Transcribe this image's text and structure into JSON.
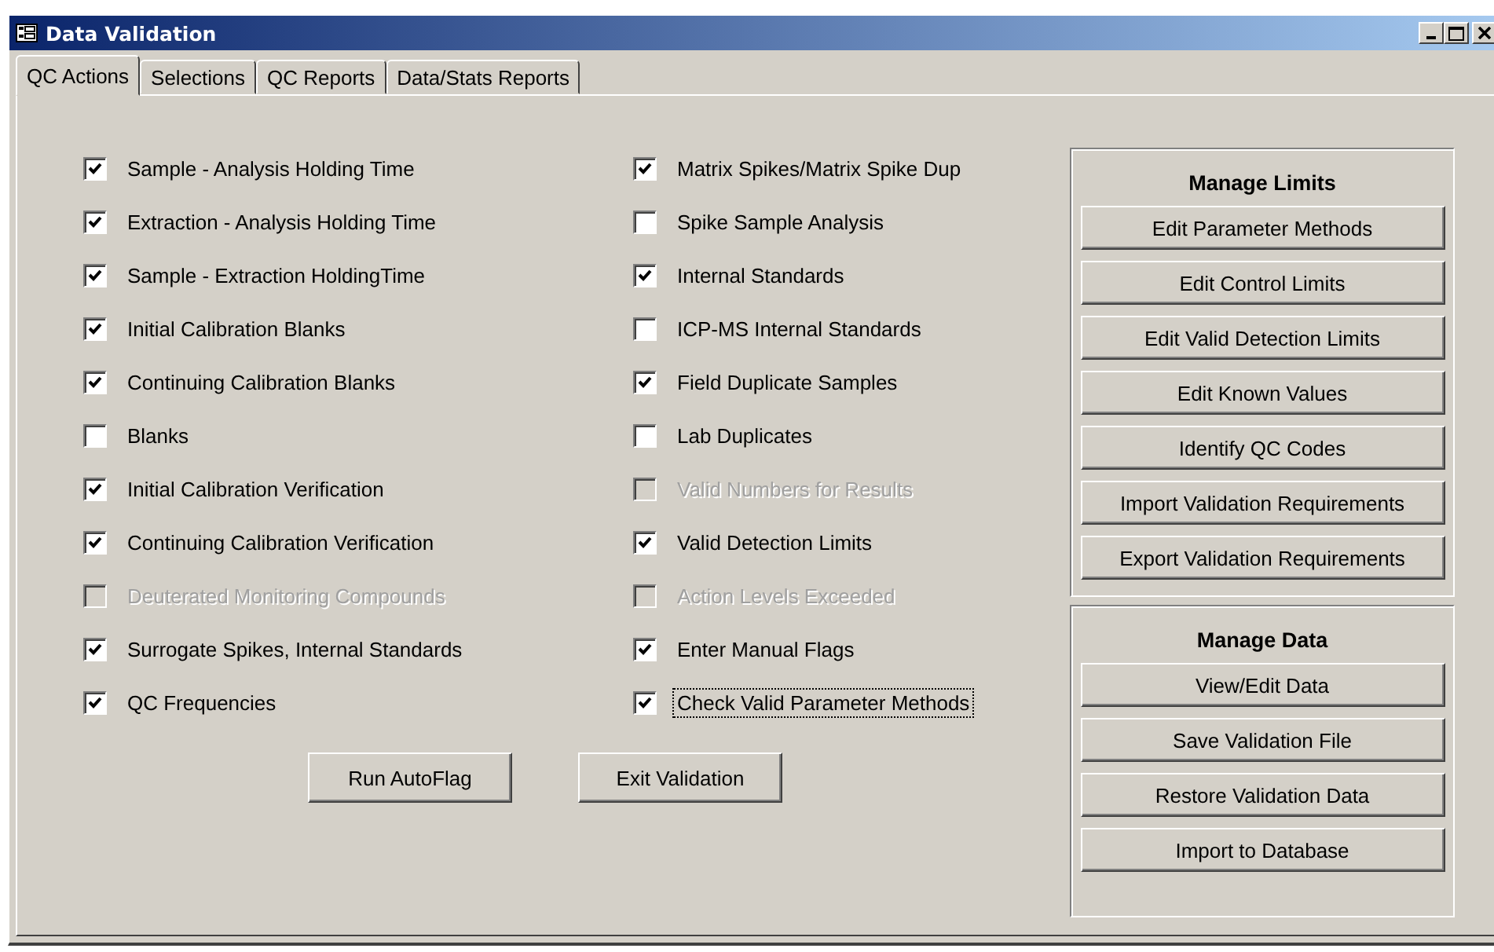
{
  "window": {
    "title": "Data Validation"
  },
  "tabs": [
    {
      "label": "QC Actions",
      "selected": true
    },
    {
      "label": "Selections",
      "selected": false
    },
    {
      "label": "QC Reports",
      "selected": false
    },
    {
      "label": "Data/Stats Reports",
      "selected": false
    }
  ],
  "checks_left": [
    {
      "label": "Sample - Analysis Holding Time",
      "checked": true,
      "disabled": false,
      "focused": false
    },
    {
      "label": "Extraction - Analysis Holding Time",
      "checked": true,
      "disabled": false,
      "focused": false
    },
    {
      "label": "Sample - Extraction HoldingTime",
      "checked": true,
      "disabled": false,
      "focused": false
    },
    {
      "label": "Initial Calibration Blanks",
      "checked": true,
      "disabled": false,
      "focused": false
    },
    {
      "label": "Continuing Calibration Blanks",
      "checked": true,
      "disabled": false,
      "focused": false
    },
    {
      "label": "Blanks",
      "checked": false,
      "disabled": false,
      "focused": false
    },
    {
      "label": "Initial Calibration Verification",
      "checked": true,
      "disabled": false,
      "focused": false
    },
    {
      "label": "Continuing Calibration Verification",
      "checked": true,
      "disabled": false,
      "focused": false
    },
    {
      "label": "Deuterated Monitoring Compounds",
      "checked": false,
      "disabled": true,
      "focused": false
    },
    {
      "label": "Surrogate Spikes, Internal Standards",
      "checked": true,
      "disabled": false,
      "focused": false
    },
    {
      "label": "QC Frequencies",
      "checked": true,
      "disabled": false,
      "focused": false
    }
  ],
  "checks_right": [
    {
      "label": "Matrix Spikes/Matrix Spike Dup",
      "checked": true,
      "disabled": false,
      "focused": false
    },
    {
      "label": "Spike Sample Analysis",
      "checked": false,
      "disabled": false,
      "focused": false
    },
    {
      "label": "Internal Standards",
      "checked": true,
      "disabled": false,
      "focused": false
    },
    {
      "label": "ICP-MS Internal Standards",
      "checked": false,
      "disabled": false,
      "focused": false
    },
    {
      "label": "Field Duplicate Samples",
      "checked": true,
      "disabled": false,
      "focused": false
    },
    {
      "label": "Lab Duplicates",
      "checked": false,
      "disabled": false,
      "focused": false
    },
    {
      "label": "Valid Numbers for Results",
      "checked": false,
      "disabled": true,
      "focused": false
    },
    {
      "label": "Valid Detection Limits",
      "checked": true,
      "disabled": false,
      "focused": false
    },
    {
      "label": "Action Levels Exceeded",
      "checked": false,
      "disabled": true,
      "focused": false
    },
    {
      "label": "Enter Manual Flags",
      "checked": true,
      "disabled": false,
      "focused": false
    },
    {
      "label": "Check Valid Parameter Methods",
      "checked": true,
      "disabled": false,
      "focused": true
    }
  ],
  "action_buttons": [
    {
      "label": "Run AutoFlag"
    },
    {
      "label": "Exit Validation"
    }
  ],
  "groups": [
    {
      "title": "Manage Limits",
      "buttons": [
        {
          "label": "Edit Parameter Methods"
        },
        {
          "label": "Edit Control Limits"
        },
        {
          "label": "Edit Valid Detection Limits"
        },
        {
          "label": "Edit Known Values"
        },
        {
          "label": "Identify QC Codes"
        },
        {
          "label": "Import Validation Requirements"
        },
        {
          "label": "Export Validation Requirements"
        }
      ]
    },
    {
      "title": "Manage Data",
      "buttons": [
        {
          "label": "View/Edit Data"
        },
        {
          "label": "Save Validation File"
        },
        {
          "label": "Restore Validation Data"
        },
        {
          "label": "Import to Database"
        }
      ]
    }
  ]
}
